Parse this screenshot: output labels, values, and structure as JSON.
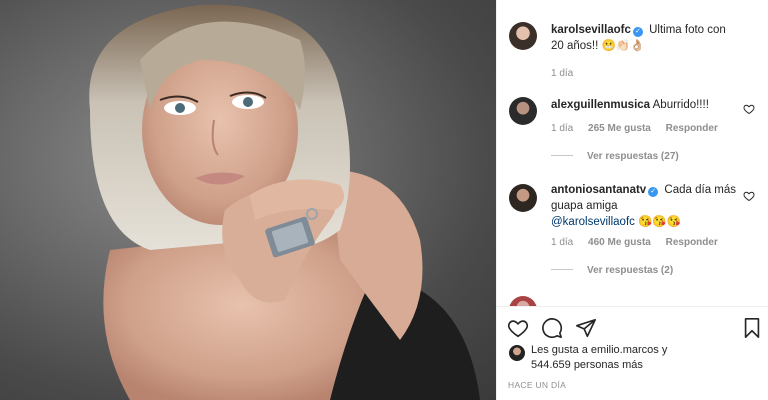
{
  "post": {
    "author": "karolsevillaofc",
    "caption": "Ultima foto con 20 años!! 😬👏🏻👌🏼",
    "time": "1 día"
  },
  "comments": [
    {
      "username": "alexguillenmusica",
      "text": "Aburrido!!!!",
      "time": "1 día",
      "likes": "265 Me gusta",
      "reply_label": "Responder",
      "view_replies": "Ver respuestas (27)"
    },
    {
      "username": "antoniosantanatv",
      "text": "Cada día más guapa amiga",
      "mention": "@karolsevillaofc",
      "emoji": "😘😘😘",
      "time": "1 día",
      "likes": "460 Me gusta",
      "reply_label": "Responder",
      "view_replies": "Ver respuestas (2)"
    }
  ],
  "likes_summary": {
    "line1": "Les gusta a emilio.marcos y",
    "line2": "544.659 personas más"
  },
  "timestamp": "HACE UN DÍA",
  "icons": {
    "like": "heart-icon",
    "comment": "comment-icon",
    "share": "send-icon",
    "save": "bookmark-icon",
    "verified": "verified-badge-icon"
  },
  "colors": {
    "verified": "#3897f0",
    "muted_text": "#8e8e8e",
    "text": "#262626"
  }
}
